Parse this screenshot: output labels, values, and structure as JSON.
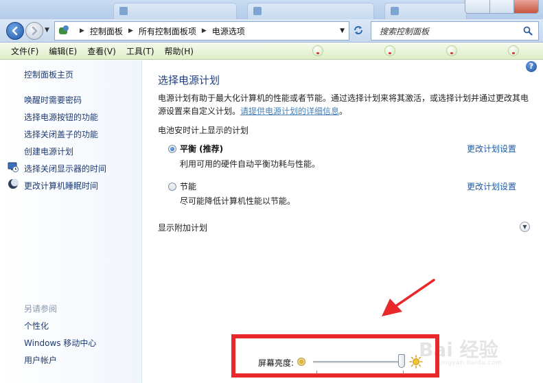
{
  "window": {
    "ghost_tabs": 4
  },
  "address_bar": {
    "breadcrumbs": [
      "控制面板",
      "所有控制面板项",
      "电源选项"
    ],
    "search_placeholder": "搜索控制面板"
  },
  "menu": {
    "items": [
      "文件(F)",
      "编辑(E)",
      "查看(V)",
      "工具(T)",
      "帮助(H)"
    ]
  },
  "sidebar": {
    "home": "控制面板主页",
    "links": [
      {
        "label": "唤醒时需要密码",
        "icon": ""
      },
      {
        "label": "选择电源按钮的功能",
        "icon": ""
      },
      {
        "label": "选择关闭盖子的功能",
        "icon": ""
      },
      {
        "label": "创建电源计划",
        "icon": ""
      },
      {
        "label": "选择关闭显示器的时间",
        "icon": "monitor-clock-icon"
      },
      {
        "label": "更改计算机睡眠时间",
        "icon": "moon-icon"
      }
    ],
    "see_also_title": "另请参阅",
    "see_also": [
      "个性化",
      "Windows 移动中心",
      "用户帐户"
    ]
  },
  "main": {
    "title": "选择电源计划",
    "description": "电源计划有助于最大化计算机的性能或者节能。通过选择计划来将其激活，或选择计划并通过更改其电源设置来自定义计划。",
    "description_link": "请提供电源计划的详细信息",
    "description_end": "。",
    "group_title": "电池安时计上显示的计划",
    "plans": [
      {
        "name": "平衡 (推荐)",
        "description": "利用可用的硬件自动平衡功耗与性能。",
        "selected": true,
        "link": "更改计划设置"
      },
      {
        "name": "节能",
        "description": "尽可能降低计算机性能以节能。",
        "selected": false,
        "link": "更改计划设置"
      }
    ],
    "more_plans": "显示附加计划",
    "help_glyph": "?"
  },
  "brightness": {
    "label": "屏幕亮度:",
    "level": 0.98
  },
  "colors": {
    "link": "#1c5aa8",
    "title": "#1e3f80",
    "highlight": "#e8282a",
    "menubar": "#dfeeca"
  },
  "watermark": {
    "text": "Bai 经验",
    "url": "jingyan.baidu.com"
  }
}
